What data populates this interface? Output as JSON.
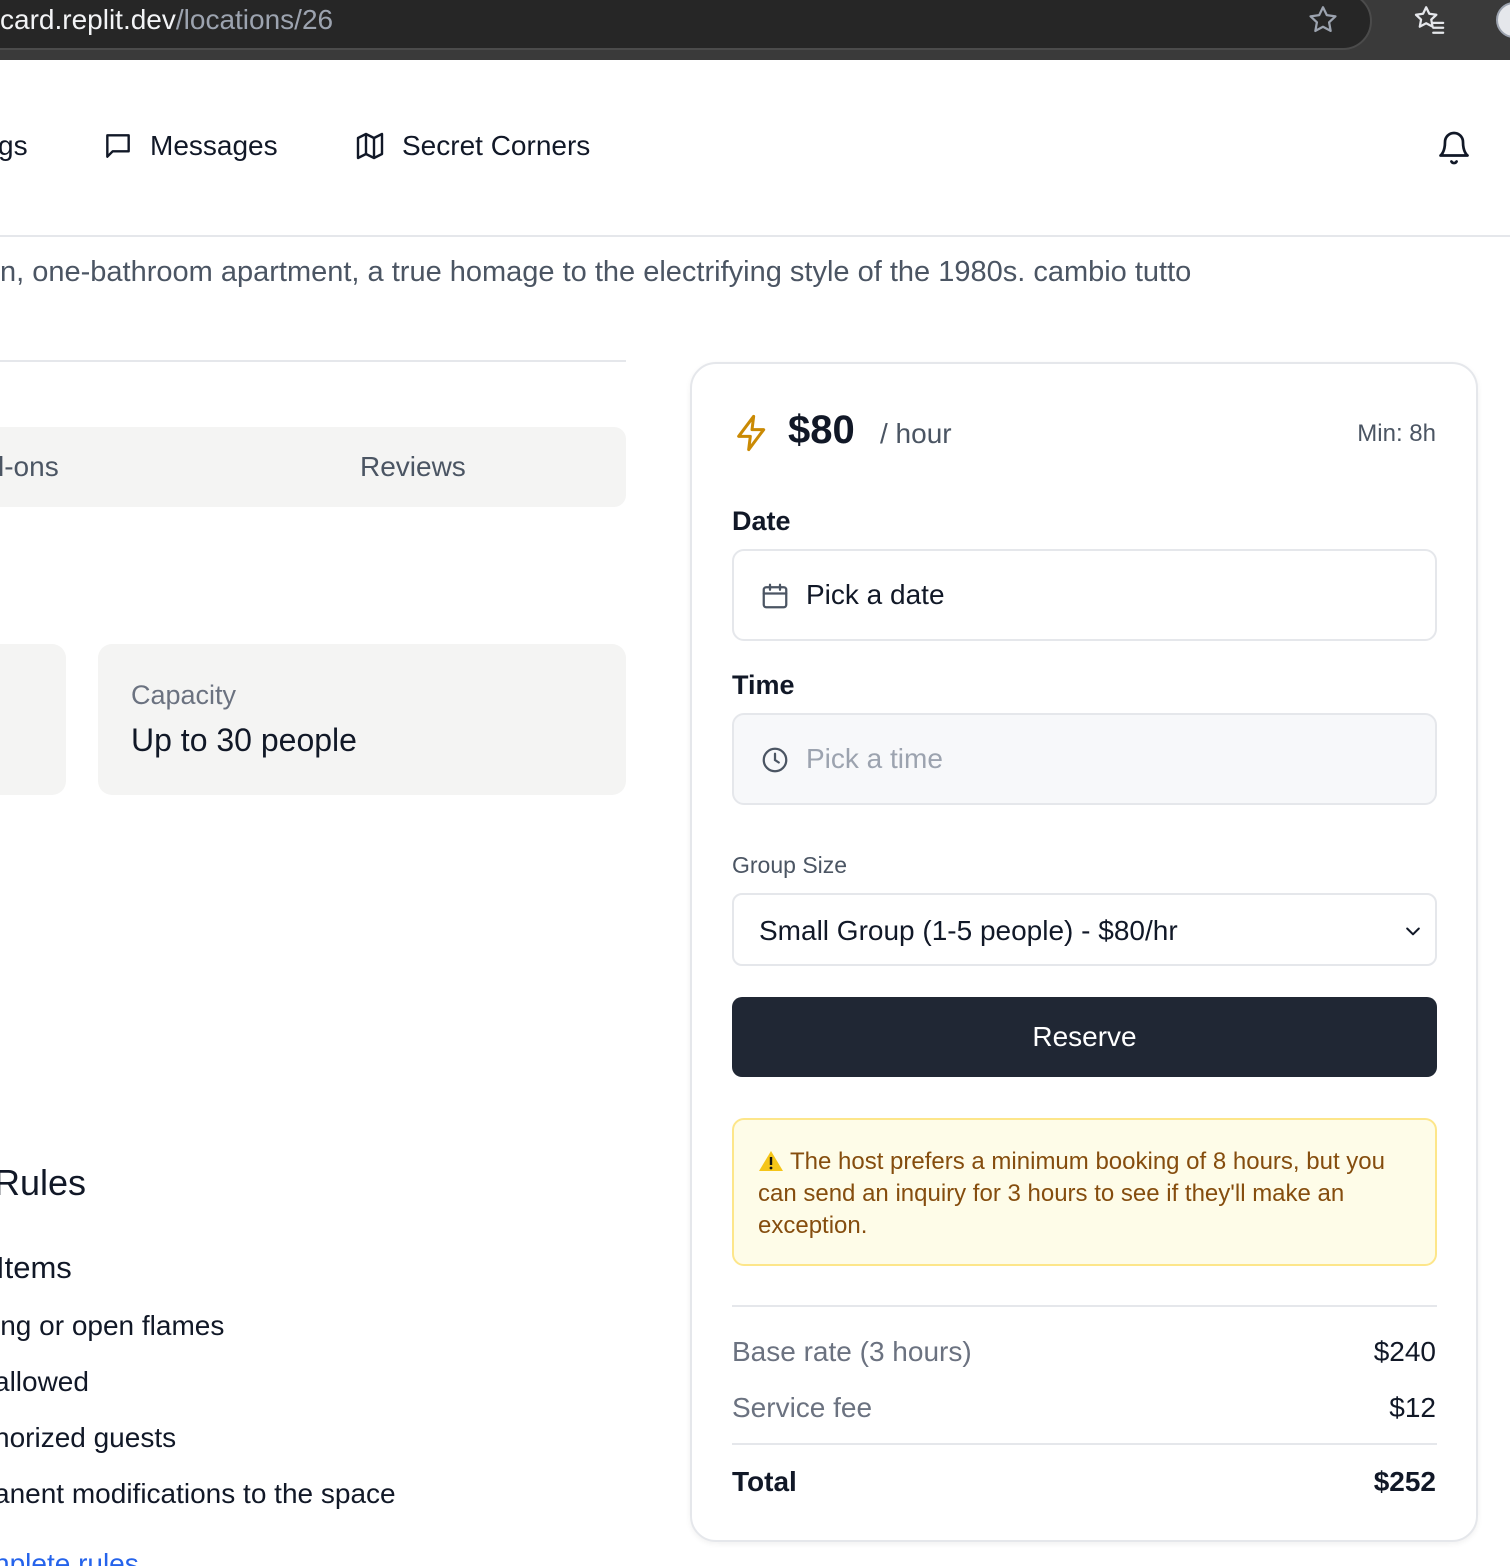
{
  "browser": {
    "url_host": "card.replit.dev",
    "url_path": "/locations/26"
  },
  "nav": {
    "items": [
      {
        "label": "gs",
        "icon": "none"
      },
      {
        "label": "Messages",
        "icon": "message-square-icon"
      },
      {
        "label": "Secret Corners",
        "icon": "map-icon"
      }
    ],
    "notifications_icon": "bell-icon"
  },
  "listing": {
    "description": "n, one-bathroom apartment, a true homage to the electrifying style of the 1980s. cambio tutto"
  },
  "tabs": [
    "l-ons",
    "Reviews"
  ],
  "capacity": {
    "label": "Capacity",
    "value": "Up to 30 people"
  },
  "rules": {
    "heading": "Rules",
    "subheading": "Items",
    "items": [
      "ing or open flames",
      "allowed",
      "horized guests",
      "anent modifications to the space"
    ],
    "link": "nplete rules"
  },
  "booking": {
    "price": "$80",
    "per": "/ hour",
    "minimum": "Min: 8h",
    "accent_color": "#ca8a04",
    "date": {
      "label": "Date",
      "value": "Pick a date"
    },
    "time": {
      "label": "Time",
      "value": "Pick a time"
    },
    "group_size": {
      "label": "Group Size",
      "selected": "Small Group (1-5 people) - $80/hr"
    },
    "reserve_label": "Reserve",
    "warning": "The host prefers a minimum booking of 8 hours, but you can send an inquiry for 3 hours to see if they'll make an exception.",
    "breakdown": [
      {
        "label": "Base rate (3 hours)",
        "value": "$240"
      },
      {
        "label": "Service fee",
        "value": "$12"
      }
    ],
    "total": {
      "label": "Total",
      "value": "$252"
    }
  }
}
